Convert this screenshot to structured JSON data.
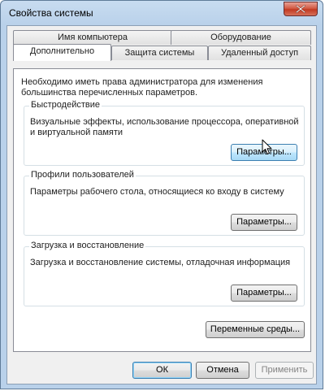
{
  "window": {
    "title": "Свойства системы"
  },
  "tabs": {
    "row_back": [
      {
        "label": "Имя компьютера"
      },
      {
        "label": "Оборудование"
      }
    ],
    "row_front": [
      {
        "label": "Дополнительно",
        "active": true
      },
      {
        "label": "Защита системы"
      },
      {
        "label": "Удаленный доступ"
      }
    ]
  },
  "panel": {
    "intro": "Необходимо иметь права администратора для изменения большинства перечисленных параметров.",
    "groups": [
      {
        "label": "Быстродействие",
        "description": "Визуальные эффекты, использование процессора, оперативной и виртуальной памяти",
        "button": "Параметры..."
      },
      {
        "label": "Профили пользователей",
        "description": "Параметры рабочего стола, относящиеся ко входу в систему",
        "button": "Параметры..."
      },
      {
        "label": "Загрузка и восстановление",
        "description": "Загрузка и восстановление системы, отладочная информация",
        "button": "Параметры..."
      }
    ],
    "env_button": "Переменные среды..."
  },
  "footer": {
    "ok": "ОК",
    "cancel": "Отмена",
    "apply": "Применить"
  },
  "icons": {
    "close": "close-icon",
    "cursor": "mouse-pointer-icon"
  }
}
